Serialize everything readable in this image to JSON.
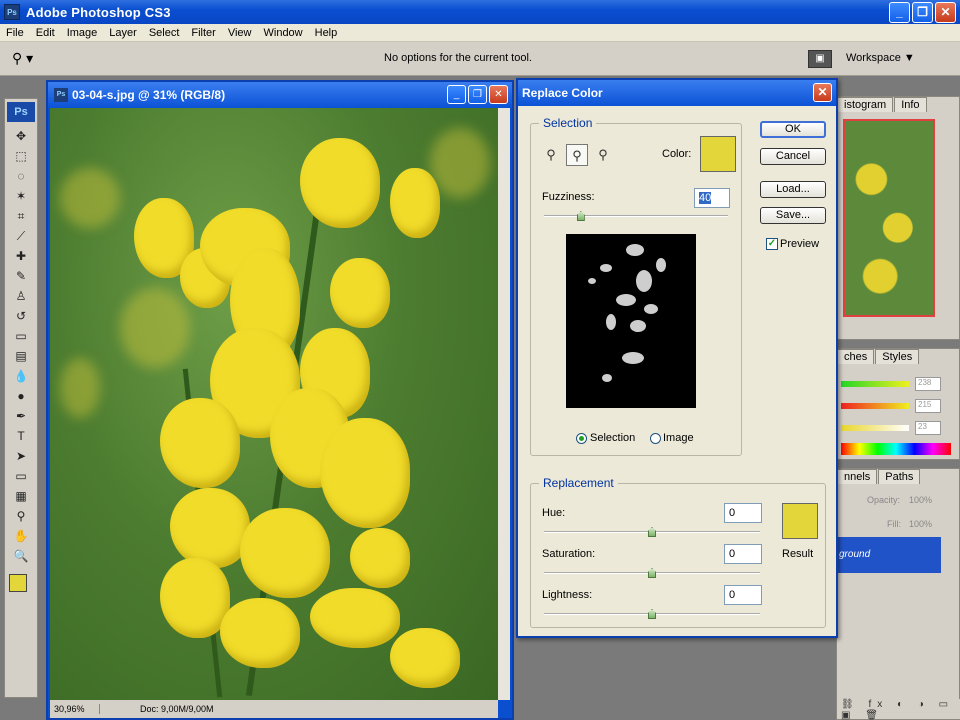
{
  "app": {
    "title": "Adobe Photoshop CS3",
    "icon_label": "Ps",
    "window_buttons": [
      "_",
      "❐",
      "✕"
    ]
  },
  "menu": [
    "File",
    "Edit",
    "Image",
    "Layer",
    "Select",
    "Filter",
    "View",
    "Window",
    "Help"
  ],
  "options_bar": {
    "message": "No options for the current tool.",
    "workspace_label": "Workspace ▼"
  },
  "tools": {
    "logo": "Ps",
    "items": [
      {
        "name": "move-tool",
        "glyph": "✥"
      },
      {
        "name": "marquee-tool",
        "glyph": "⬚"
      },
      {
        "name": "lasso-tool",
        "glyph": "◌"
      },
      {
        "name": "magic-wand-tool",
        "glyph": "✶"
      },
      {
        "name": "crop-tool",
        "glyph": "⌗"
      },
      {
        "name": "slice-tool",
        "glyph": "⟋"
      },
      {
        "name": "healing-brush-tool",
        "glyph": "✚"
      },
      {
        "name": "brush-tool",
        "glyph": "✎"
      },
      {
        "name": "clone-stamp-tool",
        "glyph": "♙"
      },
      {
        "name": "history-brush-tool",
        "glyph": "↺"
      },
      {
        "name": "eraser-tool",
        "glyph": "▭"
      },
      {
        "name": "gradient-tool",
        "glyph": "▤"
      },
      {
        "name": "blur-tool",
        "glyph": "💧"
      },
      {
        "name": "dodge-tool",
        "glyph": "●"
      },
      {
        "name": "pen-tool",
        "glyph": "✒"
      },
      {
        "name": "type-tool",
        "glyph": "T"
      },
      {
        "name": "path-selection-tool",
        "glyph": "➤"
      },
      {
        "name": "shape-tool",
        "glyph": "▭"
      },
      {
        "name": "notes-tool",
        "glyph": "▦"
      },
      {
        "name": "eyedropper-tool",
        "glyph": "⚲"
      },
      {
        "name": "hand-tool",
        "glyph": "✋"
      },
      {
        "name": "zoom-tool",
        "glyph": "🔍"
      }
    ],
    "foreground_color": "#e3d63a",
    "background_color": "#ffffff"
  },
  "document": {
    "title": "03-04-s.jpg @ 31% (RGB/8)",
    "zoom": "30,96%",
    "doc_info": "Doc: 9,00M/9,00M"
  },
  "panels": {
    "navigator_tabs": [
      "istogram",
      "Info"
    ],
    "color_tabs": [
      "ches",
      "Styles"
    ],
    "color_values": [
      "238",
      "215",
      "23"
    ],
    "layers_tabs": [
      "nnels",
      "Paths"
    ],
    "opacity_label": "Opacity:",
    "opacity_value": "100%",
    "fill_label": "Fill:",
    "fill_value": "100%",
    "layer_name": "ground",
    "footer_icons": "⛓ fx ◐ ◑ ▭ ▣ 🗑"
  },
  "dialog": {
    "title": "Replace Color",
    "buttons": {
      "ok": "OK",
      "cancel": "Cancel",
      "load": "Load...",
      "save": "Save..."
    },
    "preview_label": "Preview",
    "preview_checked": true,
    "selection": {
      "legend": "Selection",
      "color_label": "Color:",
      "color": "#e3d63a",
      "fuzziness_label": "Fuzziness:",
      "fuzziness_value": "40",
      "fuzziness_fraction": 0.2,
      "radio_selection": "Selection",
      "radio_image": "Image",
      "selected_mode": "Selection"
    },
    "replacement": {
      "legend": "Replacement",
      "hue_label": "Hue:",
      "hue_value": "0",
      "saturation_label": "Saturation:",
      "saturation_value": "0",
      "lightness_label": "Lightness:",
      "lightness_value": "0",
      "result_label": "Result",
      "result_color": "#e3d63a"
    }
  }
}
